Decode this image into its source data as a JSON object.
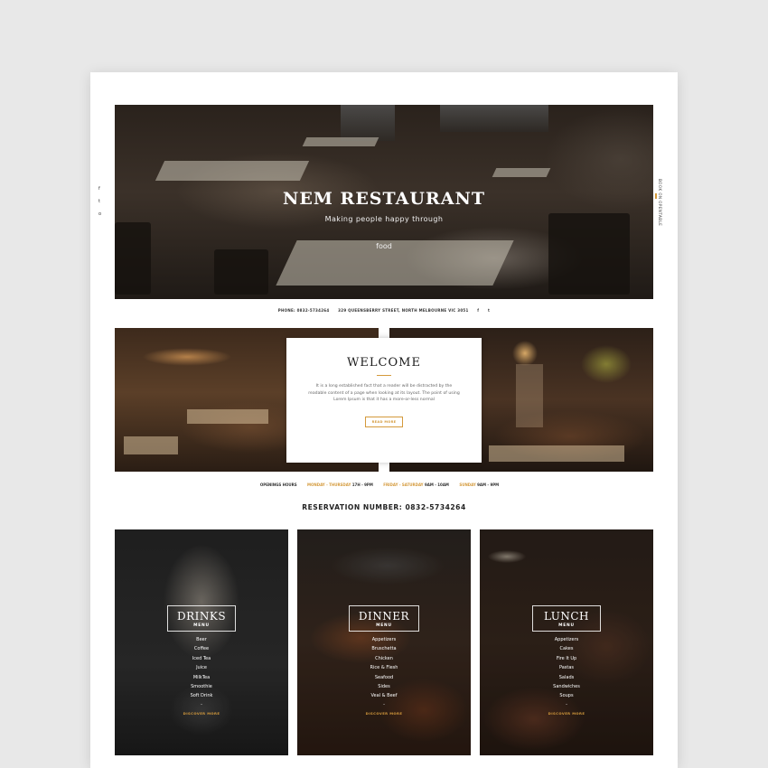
{
  "social": {
    "icons": [
      "f",
      "t",
      "o"
    ]
  },
  "side_right": {
    "text": "BOOK ON OPENTABLE"
  },
  "hero": {
    "title": "NEM RESTAURANT",
    "subtitle_line1": "Making people happy through",
    "subtitle_line2": "food"
  },
  "contact": {
    "phone": "PHONE: 0832-5734264",
    "address": "329 QUEENSBERRY STREET, NORTH MELBOURNE VIC 3051",
    "social": [
      "f",
      "t"
    ]
  },
  "welcome": {
    "title": "WELCOME",
    "text": "It is a long established fact that a reader will be distracted by the readable content of a page when looking at its layout. The point of using Lorem Ipsum is that it has a more-or-less normal",
    "button": "READ MORE"
  },
  "hours": {
    "label": "OPENINGS HOURS",
    "slots": [
      {
        "day": "MONDAY - THURSDAY",
        "time": "17H - 9PM"
      },
      {
        "day": "FRIDAY - SATURDAY",
        "time": "9AM - 10AM"
      },
      {
        "day": "SUNDAY",
        "time": "9AM - 9PM"
      }
    ]
  },
  "reservation": "RESERVATION NUMBER: 0832-5734264",
  "menus": [
    {
      "title": "DRINKS",
      "sub": "MENU",
      "items": [
        "Beer",
        "Coffee",
        "Iced Tea",
        "Juice",
        "MilkTea",
        "Smoothie",
        "Soft Drink"
      ],
      "dash": "-",
      "discover": "DISCOVER MORE"
    },
    {
      "title": "DINNER",
      "sub": "MENU",
      "items": [
        "Appetizers",
        "Bruschetta",
        "Chicken",
        "Rice & Flesh",
        "Seafood",
        "Sides",
        "Veal & Beef"
      ],
      "dash": "-",
      "discover": "DISCOVER MORE"
    },
    {
      "title": "LUNCH",
      "sub": "MENU",
      "items": [
        "Appetizers",
        "Cakes",
        "Fire It Up",
        "Pastas",
        "Salads",
        "Sandwiches",
        "Soups"
      ],
      "dash": "-",
      "discover": "DISCOVER MORE"
    }
  ],
  "colors": {
    "accent": "#d49a3c",
    "page": "#ffffff",
    "backdrop": "#e8e8e8"
  }
}
